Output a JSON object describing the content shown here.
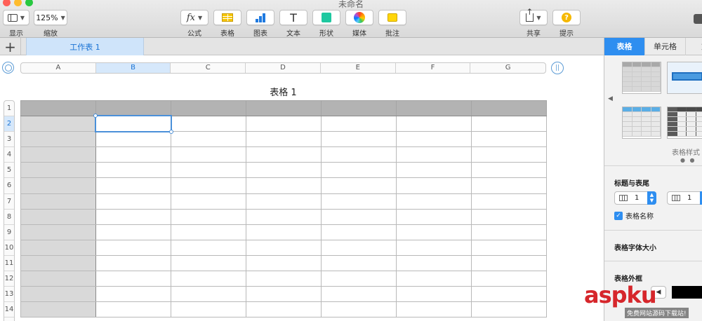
{
  "window": {
    "title": "未命名"
  },
  "toolbar": {
    "view_label": "显示",
    "zoom_value": "125%",
    "zoom_label": "缩放",
    "formula_label": "公式",
    "table_label": "表格",
    "chart_label": "图表",
    "text_label": "文本",
    "shape_label": "形状",
    "media_label": "媒体",
    "comment_label": "批注",
    "share_label": "共享",
    "tips_label": "提示"
  },
  "sheet": {
    "add_symbol": "+",
    "tab_name": "工作表 1"
  },
  "table": {
    "title": "表格 1",
    "columns": [
      "A",
      "B",
      "C",
      "D",
      "E",
      "F",
      "G"
    ],
    "rows": [
      "1",
      "2",
      "3",
      "4",
      "5",
      "6",
      "7",
      "8",
      "9",
      "10",
      "11",
      "12",
      "13",
      "14"
    ],
    "selected_column": "B",
    "selected_row": "2"
  },
  "inspector": {
    "tabs": [
      "表格",
      "单元格",
      "文"
    ],
    "active_tab": "表格",
    "styles_label": "表格样式",
    "headers_footers_label": "标题与表尾",
    "header_rows_value": "1",
    "header_cols_value": "1",
    "show_name_label": "表格名称",
    "show_name_checked": true,
    "font_size_label": "表格字体大小",
    "outline_label": "表格外框"
  },
  "watermark": {
    "logo": "aspku",
    "caption": "免费网站源码下载站!"
  },
  "colors": {
    "accent": "#2e8ef0",
    "selection": "#4a90d9",
    "header_fill": "#b3b3b3",
    "header_column_fill": "#d9d9d9"
  }
}
